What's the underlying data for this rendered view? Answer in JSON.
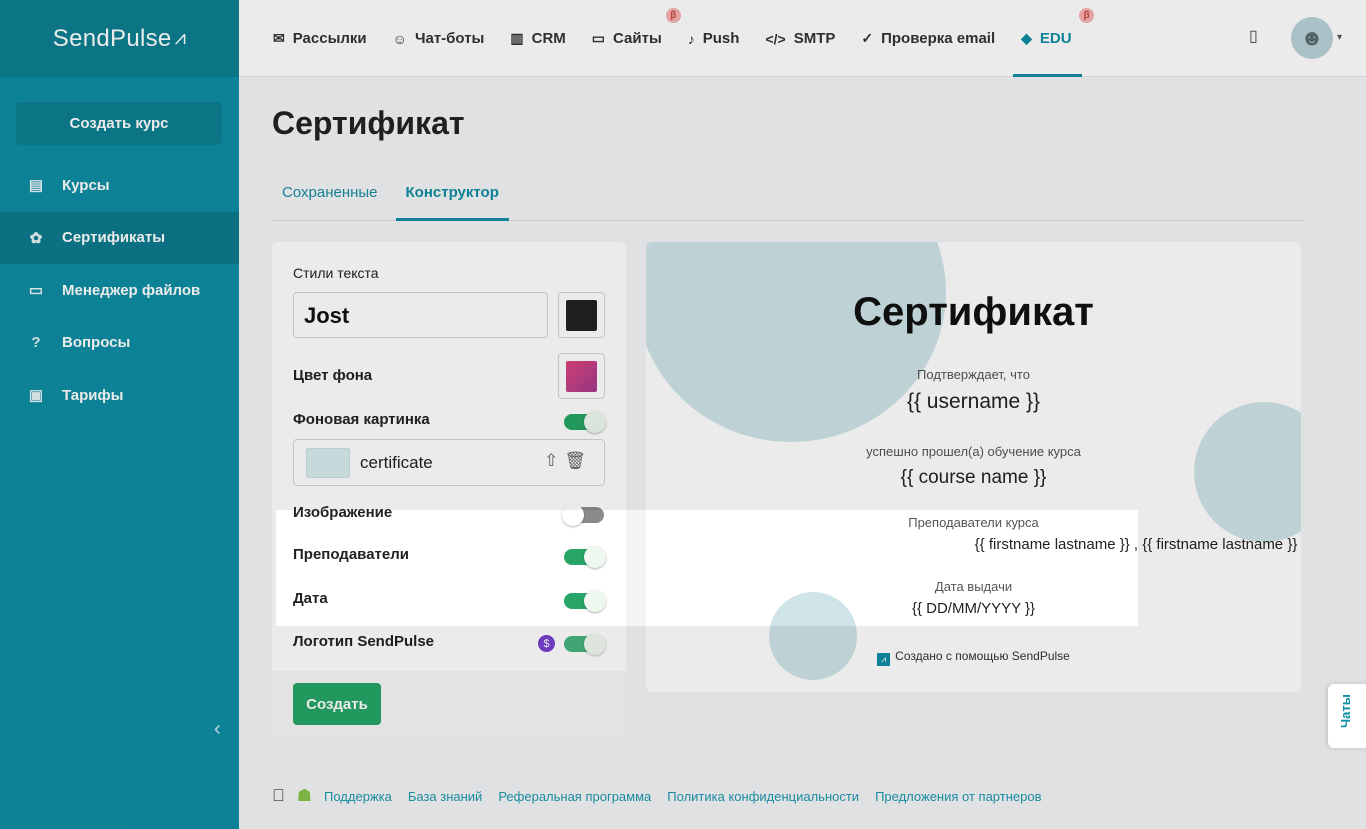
{
  "logo": {
    "text": "SendPulse",
    "mark": "⩘"
  },
  "sidebar": {
    "create_label": "Создать курс",
    "items": [
      {
        "label": "Курсы",
        "icon": "courses-icon",
        "glyph": "▤"
      },
      {
        "label": "Сертификаты",
        "icon": "certificate-icon",
        "glyph": "✿"
      },
      {
        "label": "Менеджер файлов",
        "icon": "folder-icon",
        "glyph": "▭"
      },
      {
        "label": "Вопросы",
        "icon": "question-icon",
        "glyph": "?"
      },
      {
        "label": "Тарифы",
        "icon": "wallet-icon",
        "glyph": "▣"
      }
    ],
    "active_index": 1,
    "collapse_glyph": "‹"
  },
  "topnav": {
    "items": [
      {
        "label": "Рассылки",
        "glyph": "✉"
      },
      {
        "label": "Чат-боты",
        "glyph": "☺"
      },
      {
        "label": "CRM",
        "glyph": "▥"
      },
      {
        "label": "Сайты",
        "glyph": "▭",
        "beta": "β"
      },
      {
        "label": "Push",
        "glyph": "♪"
      },
      {
        "label": "SMTP",
        "glyph": "</>"
      },
      {
        "label": "Проверка email",
        "glyph": "✓"
      },
      {
        "label": "EDU",
        "glyph": "◆",
        "beta": "β"
      }
    ],
    "active_index": 7,
    "mobile_glyph": "▯",
    "avatar_glyph": "☻",
    "caret": "▾"
  },
  "page": {
    "title": "Сертификат"
  },
  "tabs": [
    {
      "label": "Сохраненные"
    },
    {
      "label": "Конструктор"
    }
  ],
  "settings": {
    "text_styles_label": "Стили текста",
    "font_value": "Jost",
    "text_color": "#222222",
    "bg_color_label": "Цвет фона",
    "bg_gradient": [
      "#e0457b",
      "#a23b8f"
    ],
    "bg_image_label": "Фоновая картинка",
    "bg_image_on": true,
    "file_name": "certificate",
    "file_actions": "⇧🗑",
    "image_label": "Изображение",
    "image_on": false,
    "teachers_label": "Преподаватели",
    "teachers_on": true,
    "date_label": "Дата",
    "date_on": true,
    "logo_label": "Логотип SendPulse",
    "logo_on": true,
    "paid_badge": "$",
    "create_button": "Создать"
  },
  "certificate": {
    "title": "Сертификат",
    "confirms": "Подтверждает, что",
    "username": "{{ username }}",
    "completed": "успешно прошел(а) обучение курса",
    "course_name": "{{ course name }}",
    "teachers_label": "Преподаватели курса",
    "teachers_value": "{{ firstname lastname }} , {{ firstname lastname }}",
    "date_label": "Дата выдачи",
    "date_value": "{{ DD/MM/YYYY }}",
    "made_with": "Создано с помощью SendPulse"
  },
  "chats_tab": "Чаты",
  "footer": {
    "links": [
      "Поддержка",
      "База знаний",
      "Реферальная программа",
      "Политика конфиденциальности",
      "Предложения от партнеров"
    ],
    "apple_glyph": "",
    "android_glyph": "☗"
  },
  "colors": {
    "brand": "#0f8ea3",
    "accent_green": "#27a567"
  }
}
